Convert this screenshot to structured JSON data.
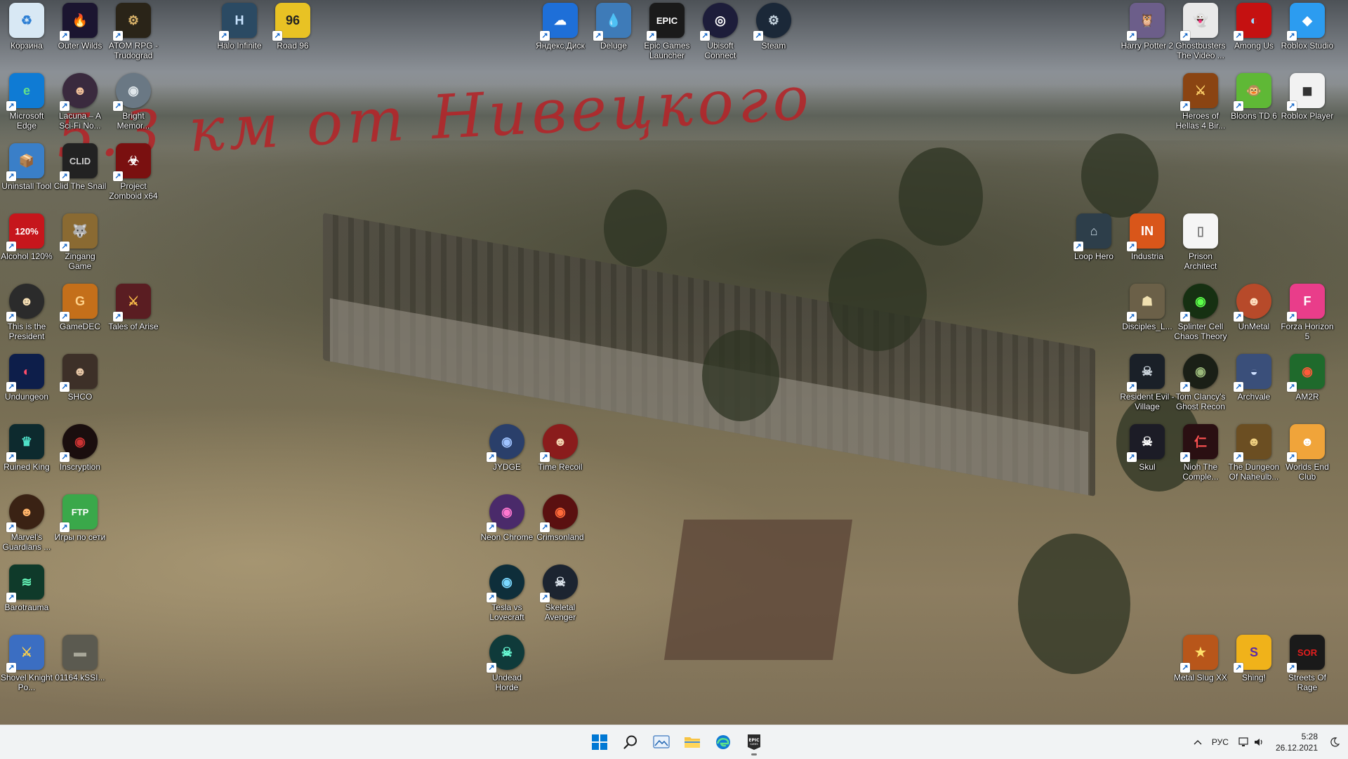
{
  "wallpaper": {
    "scrawl_text": "5.3 км от Нивецкого"
  },
  "desktop_icons": [
    {
      "label": "Корзина",
      "color": "#d8e8f4",
      "glyph": "♻",
      "fg": "#2d7fd4"
    },
    {
      "label": "Outer Wilds",
      "color": "#1b1530",
      "glyph": "🔥",
      "fg": "#ff8a00"
    },
    {
      "label": "ATOM RPG - Trudograd",
      "color": "#2a2418",
      "glyph": "⚙",
      "fg": "#d9b36a"
    },
    {
      "label": "Halo Infinite",
      "color": "#2b4a63",
      "glyph": "H",
      "fg": "#c9e4ff"
    },
    {
      "label": "Road 96",
      "color": "#e8c224",
      "glyph": "96",
      "fg": "#222"
    },
    {
      "label": "Яндекс.Диск",
      "color": "#1e6fd8",
      "glyph": "☁",
      "fg": "#fff"
    },
    {
      "label": "Deluge",
      "color": "#3e7bb8",
      "glyph": "💧",
      "fg": "#bfe0ff"
    },
    {
      "label": "Epic Games Launcher",
      "color": "#1a1a1a",
      "glyph": "EPIC",
      "fg": "#fff"
    },
    {
      "label": "Ubisoft Connect",
      "color": "#1d1d3a",
      "glyph": "◎",
      "fg": "#fff"
    },
    {
      "label": "Steam",
      "color": "#1b2838",
      "glyph": "⚙",
      "fg": "#c7d5e0"
    },
    {
      "label": "Harry Potter 2",
      "color": "#6c5e8a",
      "glyph": "🦉",
      "fg": "#fff"
    },
    {
      "label": "Ghostbusters The Video ...",
      "color": "#e9e9e9",
      "glyph": "👻",
      "fg": "#c00"
    },
    {
      "label": "Among Us",
      "color": "#c51111",
      "glyph": "◐",
      "fg": "#9ed9ff"
    },
    {
      "label": "Roblox Studio",
      "color": "#2c9cf0",
      "glyph": "◆",
      "fg": "#fff"
    },
    {
      "label": "Microsoft Edge",
      "color": "#0f7bd4",
      "glyph": "e",
      "fg": "#64e08a"
    },
    {
      "label": "Lacuna – A Sci-Fi No...",
      "color": "#3a2a3e",
      "glyph": "☻",
      "fg": "#f0c09a"
    },
    {
      "label": "Bright Memor...",
      "color": "#6a7884",
      "glyph": "◉",
      "fg": "#dfe6ea"
    },
    {
      "label": "Heroes of Hellas 4 Bir...",
      "color": "#8a4412",
      "glyph": "⚔",
      "fg": "#ffd26a"
    },
    {
      "label": "Bloons TD 6",
      "color": "#5fb836",
      "glyph": "🐵",
      "fg": "#fff"
    },
    {
      "label": "Roblox Player",
      "color": "#f2f2f2",
      "glyph": "◼",
      "fg": "#333"
    },
    {
      "label": "Uninstall Tool",
      "color": "#3a7fc8",
      "glyph": "📦",
      "fg": "#ffd24a"
    },
    {
      "label": "Clid The Snail",
      "color": "#222",
      "glyph": "CLID",
      "fg": "#ccc"
    },
    {
      "label": "Project Zomboid x64",
      "color": "#7a1010",
      "glyph": "☣",
      "fg": "#fff"
    },
    {
      "label": "Alcohol 120%",
      "color": "#c6161c",
      "glyph": "120%",
      "fg": "#fff"
    },
    {
      "label": "Zingang Game",
      "color": "#8a6a32",
      "glyph": "🐺",
      "fg": "#fff"
    },
    {
      "label": "Loop Hero",
      "color": "#2d3e4a",
      "glyph": "⌂",
      "fg": "#c9d9e4"
    },
    {
      "label": "Industria",
      "color": "#d9561a",
      "glyph": "IN",
      "fg": "#fff"
    },
    {
      "label": "Prison Architect",
      "color": "#f5f5f5",
      "glyph": "▯",
      "fg": "#777"
    },
    {
      "label": "This is the President",
      "color": "#2b2b2b",
      "glyph": "☻",
      "fg": "#f5deb3"
    },
    {
      "label": "GameDEC",
      "color": "#c46f1a",
      "glyph": "G",
      "fg": "#ffd28a"
    },
    {
      "label": "Tales of Arise",
      "color": "#5a1d22",
      "glyph": "⚔",
      "fg": "#ffc14a"
    },
    {
      "label": "Disciples_L...",
      "color": "#6b6048",
      "glyph": "☗",
      "fg": "#f0e0b0"
    },
    {
      "label": "Splinter Cell Chaos Theory",
      "color": "#163012",
      "glyph": "◉",
      "fg": "#5cff4a"
    },
    {
      "label": "UnMetal",
      "color": "#b74a2a",
      "glyph": "☻",
      "fg": "#ffe0c0"
    },
    {
      "label": "Forza Horizon 5",
      "color": "#e93d8a",
      "glyph": "F",
      "fg": "#fff"
    },
    {
      "label": "Undungeon",
      "color": "#0d1e4a",
      "glyph": "◐",
      "fg": "#ff4d6a"
    },
    {
      "label": "SHCO",
      "color": "#3d3028",
      "glyph": "☻",
      "fg": "#e9c9a8"
    },
    {
      "label": "Resident Evil - Village",
      "color": "#1a2028",
      "glyph": "☠",
      "fg": "#cfd8e0"
    },
    {
      "label": "Tom Clancy's Ghost Recon",
      "color": "#1a1f16",
      "glyph": "◉",
      "fg": "#9ab87a"
    },
    {
      "label": "Archvale",
      "color": "#3a4f7a",
      "glyph": "◒",
      "fg": "#cfe0ff"
    },
    {
      "label": "AM2R",
      "color": "#1f6a2c",
      "glyph": "◉",
      "fg": "#ff5a3a"
    },
    {
      "label": "Ruined King",
      "color": "#0d2a2e",
      "glyph": "♛",
      "fg": "#4fe0c8"
    },
    {
      "label": "Inscryption",
      "color": "#1a0e0e",
      "glyph": "◉",
      "fg": "#c33"
    },
    {
      "label": "JYDGE",
      "color": "#2a3f6a",
      "glyph": "◉",
      "fg": "#9fc3ff"
    },
    {
      "label": "Time Recoil",
      "color": "#8a1c1c",
      "glyph": "☻",
      "fg": "#f2d3b0"
    },
    {
      "label": "Skul",
      "color": "#1c1c26",
      "glyph": "☠",
      "fg": "#fff"
    },
    {
      "label": "Nioh The Comple...",
      "color": "#2a0f12",
      "glyph": "仁",
      "fg": "#ff5252"
    },
    {
      "label": "The Dungeon Of Naheulb...",
      "color": "#6b4e22",
      "glyph": "☻",
      "fg": "#f0d080"
    },
    {
      "label": "Worlds End Club",
      "color": "#f0a43a",
      "glyph": "☻",
      "fg": "#fff"
    },
    {
      "label": "Marvel's Guardians ...",
      "color": "#3a2214",
      "glyph": "☻",
      "fg": "#ffb46a"
    },
    {
      "label": "Игры по сети",
      "color": "#3aa84a",
      "glyph": "FTP",
      "fg": "#fff"
    },
    {
      "label": "Neon Chrome",
      "color": "#4a2a6a",
      "glyph": "◉",
      "fg": "#ff78d0"
    },
    {
      "label": "Crimsonland",
      "color": "#5a1010",
      "glyph": "◉",
      "fg": "#ff6a3a"
    },
    {
      "label": "Barotrauma",
      "color": "#0f3a2a",
      "glyph": "≋",
      "fg": "#6affc0"
    },
    {
      "label": "Tesla vs Lovecraft",
      "color": "#0e2e3a",
      "glyph": "◉",
      "fg": "#7ad8ff"
    },
    {
      "label": "Skeletal Avenger",
      "color": "#1c2430",
      "glyph": "☠",
      "fg": "#e0e8f0"
    },
    {
      "label": "Shovel Knight Po...",
      "color": "#3b6ec2",
      "glyph": "⚔",
      "fg": "#ffd24a"
    },
    {
      "label": "01164.kSSI...",
      "color": "#5b5a50",
      "glyph": "▬",
      "fg": "#a9a89a"
    },
    {
      "label": "Undead Horde",
      "color": "#0f3a3a",
      "glyph": "☠",
      "fg": "#6affd8"
    },
    {
      "label": "Metal Slug XX",
      "color": "#b8561a",
      "glyph": "★",
      "fg": "#ffe06a"
    },
    {
      "label": "Shing!",
      "color": "#f0b21a",
      "glyph": "S",
      "fg": "#5a2aa8"
    },
    {
      "label": "Streets Of Rage",
      "color": "#1a1a1a",
      "glyph": "SOR",
      "fg": "#e41e1e"
    }
  ],
  "taskbar": {
    "apps": [
      "Start",
      "Search",
      "Photos",
      "File Explorer",
      "Microsoft Edge",
      "Epic Games Launcher"
    ],
    "tray": {
      "language": "РУС",
      "time": "5:28",
      "date": "26.12.2021"
    }
  },
  "colors": {
    "taskbar_bg": "#f1f3f4",
    "scrawl": "#b3262a",
    "start_blue": "#0078d4"
  }
}
